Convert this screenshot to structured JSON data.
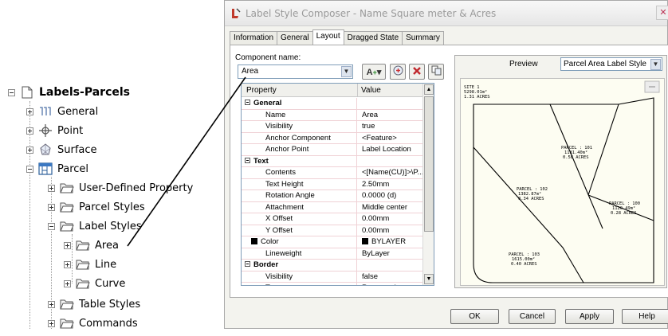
{
  "tree": {
    "root": "Labels-Parcels",
    "items": {
      "general": "General",
      "point": "Point",
      "surface": "Surface",
      "parcel": "Parcel",
      "user_defined_property": "User-Defined Property",
      "parcel_styles": "Parcel Styles",
      "label_styles": "Label Styles",
      "area": "Area",
      "line": "Line",
      "curve": "Curve",
      "table_styles": "Table Styles",
      "commands": "Commands"
    }
  },
  "dialog": {
    "title": "Label Style Composer - Name Square meter & Acres",
    "close_label": "✕",
    "tabs": [
      "Information",
      "General",
      "Layout",
      "Dragged State",
      "Summary"
    ],
    "active_tab": "Layout",
    "component_name_label": "Component name:",
    "component_name_value": "Area",
    "grid_header": {
      "property": "Property",
      "value": "Value"
    },
    "properties": [
      {
        "type": "category",
        "name": "General"
      },
      {
        "name": "Name",
        "value": "Area"
      },
      {
        "name": "Visibility",
        "value": "true"
      },
      {
        "name": "Anchor Component",
        "value": "<Feature>"
      },
      {
        "name": "Anchor Point",
        "value": "Label Location"
      },
      {
        "type": "category",
        "name": "Text"
      },
      {
        "name": "Contents",
        "value": "<[Name(CU)]>\\P..."
      },
      {
        "name": "Text Height",
        "value": "2.50mm"
      },
      {
        "name": "Rotation Angle",
        "value": "0.0000 (d)"
      },
      {
        "name": "Attachment",
        "value": "Middle center"
      },
      {
        "name": "X Offset",
        "value": "0.00mm"
      },
      {
        "name": "Y Offset",
        "value": "0.00mm"
      },
      {
        "name": "Color",
        "value": "BYLAYER",
        "swatch": true
      },
      {
        "name": "Lineweight",
        "value": "ByLayer"
      },
      {
        "type": "category",
        "name": "Border"
      },
      {
        "name": "Visibility",
        "value": "false"
      },
      {
        "name": "Type",
        "value": "Rectangular"
      }
    ],
    "preview": {
      "label": "Preview",
      "style_value": "Parcel Area Label Style",
      "labels": {
        "site": [
          "SITE 1",
          "5298.01m²",
          "1.31 ACRES"
        ],
        "p101": [
          "PARCEL : 101",
          "1181.40m²",
          "0.58 ACRES"
        ],
        "p102": [
          "PARCEL : 102",
          "1382.87m²",
          "0.34 ACRES"
        ],
        "p100": [
          "PARCEL : 100",
          "1120.49m²",
          "0.28 ACRES"
        ],
        "p103": [
          "PARCEL : 103",
          "1615.00m²",
          "0.40 ACRES"
        ]
      }
    },
    "buttons": {
      "ok": "OK",
      "cancel": "Cancel",
      "apply": "Apply",
      "help": "Help"
    }
  }
}
